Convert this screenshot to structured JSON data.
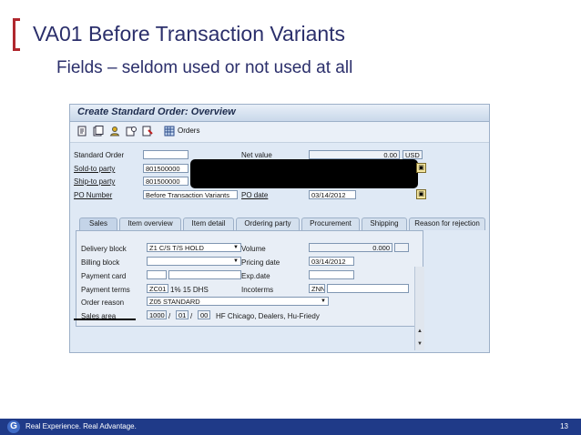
{
  "slide": {
    "title": "VA01 Before Transaction Variants",
    "subtitle": "Fields – seldom used or not used at all",
    "accent_color": "#b0282e",
    "title_color": "#2b2f6b"
  },
  "sap": {
    "window_title": "Create Standard Order: Overview",
    "toolbar": {
      "icons": [
        "display-doc-icon",
        "header-icon",
        "partner-icon",
        "item-icon",
        "flag-icon",
        "orders-icon"
      ],
      "orders_label": "Orders"
    },
    "header": {
      "standard_order_label": "Standard Order",
      "standard_order_value": "",
      "net_value_label": "Net value",
      "net_value": "0.00",
      "currency": "USD",
      "sold_to_label": "Sold-to party",
      "sold_to_value": "801500000",
      "ship_to_label": "Ship-to party",
      "ship_to_value": "801500000",
      "po_number_label": "PO Number",
      "po_number_value": "Before Transaction Variants",
      "po_date_label": "PO date",
      "po_date_value": "03/14/2012"
    },
    "tabs": [
      "Sales",
      "Item overview",
      "Item detail",
      "Ordering party",
      "Procurement",
      "Shipping",
      "Reason for rejection"
    ],
    "sales": {
      "delivery_block_label": "Delivery block",
      "delivery_block_value": "Z1 C/S T/S HOLD",
      "volume_label": "Volume",
      "volume_value": "0.000",
      "billing_block_label": "Billing block",
      "billing_block_value": "",
      "pricing_date_label": "Pricing date",
      "pricing_date_value": "03/14/2012",
      "payment_card_label": "Payment card",
      "exp_date_label": "Exp.date",
      "payment_terms_label": "Payment terms",
      "payment_terms_code": "ZC01",
      "payment_terms_text": "1% 15 DHS",
      "incoterms_label": "Incoterms",
      "incoterms_code": "ZNN",
      "order_reason_label": "Order reason",
      "order_reason_value": "Z05 STANDARD",
      "sales_area_label": "Sales area",
      "sales_org": "1000",
      "dist_channel": "01",
      "division": "00",
      "sales_area_text": "HF Chicago, Dealers, Hu-Friedy",
      "separator": "/"
    }
  },
  "footer": {
    "logo_letter": "G",
    "tagline": "Real Experience. Real Advantage.",
    "page_number": "13",
    "bar_color": "#1f3a88"
  }
}
